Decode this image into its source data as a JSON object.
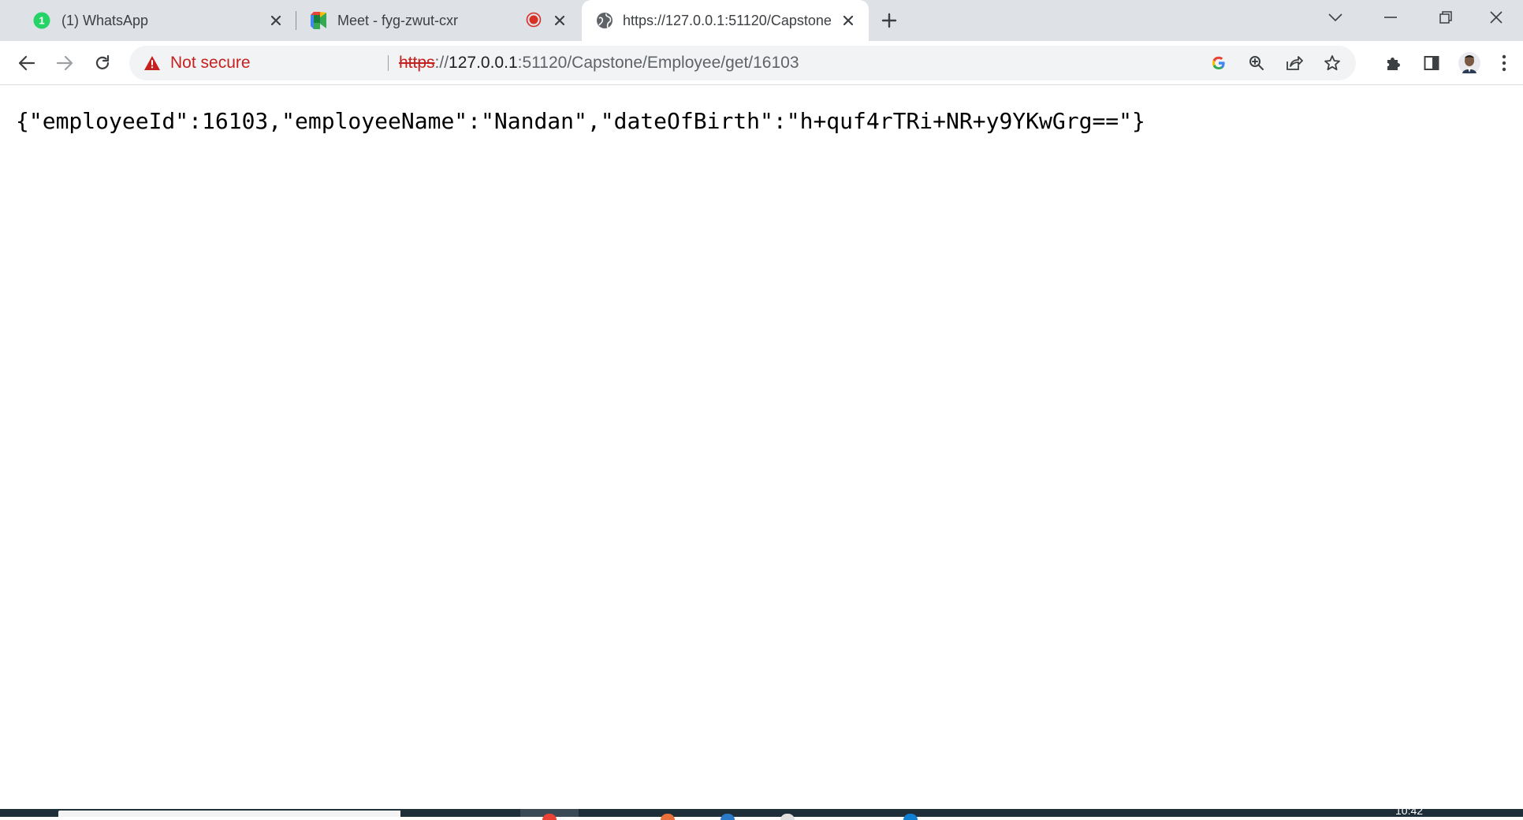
{
  "tabs": [
    {
      "title": "(1) WhatsApp",
      "badge": "1",
      "favicon": "whatsapp-icon",
      "active": false
    },
    {
      "title": "Meet - fyg-zwut-cxr",
      "favicon": "google-meet-icon",
      "recording": true,
      "active": false
    },
    {
      "title": "https://127.0.0.1:51120/Capstone",
      "favicon": "globe-icon",
      "active": true
    }
  ],
  "omnibox": {
    "status": "Not secure",
    "url_scheme": "https",
    "url_sep": "://",
    "url_host": "127.0.0.1",
    "url_rest": ":51120/Capstone/Employee/get/16103"
  },
  "page": {
    "body": "{\"employeeId\":16103,\"employeeName\":\"Nandan\",\"dateOfBirth\":\"h+quf4rTRi+NR+y9YKwGrg==\"}"
  },
  "taskbar": {
    "time": "10:42"
  },
  "colors": {
    "tabstrip": "#dee1e6",
    "not_secure": "#c5221f",
    "recording": "#d93025",
    "taskbar": "#1f2f3a"
  }
}
